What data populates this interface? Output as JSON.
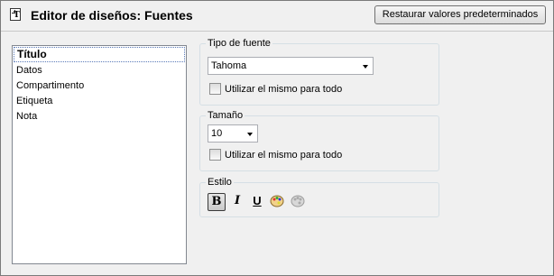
{
  "header": {
    "title": "Editor de diseños: Fuentes",
    "icon": "document-text-icon",
    "restore_button": "Restaurar valores predeterminados"
  },
  "list": {
    "items": [
      {
        "label": "Título",
        "selected": true
      },
      {
        "label": "Datos",
        "selected": false
      },
      {
        "label": "Compartimento",
        "selected": false
      },
      {
        "label": "Etiqueta",
        "selected": false
      },
      {
        "label": "Nota",
        "selected": false
      }
    ]
  },
  "font_type": {
    "label": "Tipo de fuente",
    "value": "Tahoma",
    "same_for_all_label": "Utilizar el mismo para todo",
    "same_for_all_checked": false
  },
  "size": {
    "label": "Tamaño",
    "value": "10",
    "same_for_all_label": "Utilizar el mismo para todo",
    "same_for_all_checked": false
  },
  "style": {
    "label": "Estilo",
    "bold_glyph": "B",
    "italic_glyph": "I",
    "underline_glyph": "U",
    "bold_active": true,
    "icons": [
      "bold-icon",
      "italic-icon",
      "underline-icon",
      "color-palette-icon",
      "color-palette-disabled-icon"
    ]
  },
  "colors": {
    "window_bg": "#f0f0f0",
    "list_bg": "#ffffff",
    "group_border": "#d5dfe5"
  }
}
